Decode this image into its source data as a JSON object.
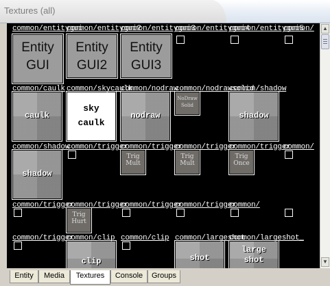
{
  "window": {
    "title": "Textures (all)"
  },
  "rows": [
    {
      "labels": [
        "common/entitygui",
        "common/entitygui2",
        "common/entitygui3",
        "common/entitygui4",
        "common/entitygui5",
        "common/"
      ],
      "thumbs": [
        {
          "kind": "entity",
          "line1": "Entity",
          "line2": "GUI"
        },
        {
          "kind": "entity",
          "line1": "Entity",
          "line2": "GUI2"
        },
        {
          "kind": "entity",
          "line1": "Entity",
          "line2": "GUI3"
        }
      ]
    },
    {
      "labels": [
        "common/caulk",
        "common/skycaulk",
        "common/nodraw",
        "common/nodrawsolid",
        "common/shadow"
      ],
      "thumbs": [
        {
          "kind": "checker",
          "word": "caulk"
        },
        {
          "kind": "sky",
          "word1": "sky",
          "word2": "caulk"
        },
        {
          "kind": "checker",
          "word": "nodraw"
        },
        {
          "kind": "small",
          "line1": "NoDraw",
          "line2": "Solid"
        },
        {
          "kind": "checker",
          "word": "shadow"
        }
      ]
    },
    {
      "labels": [
        "common/shadow",
        "common/trigger",
        "common/trigger",
        "common/trigger",
        "common/trigger",
        "common/"
      ],
      "thumbs": [
        {
          "kind": "checker",
          "word": "shadow"
        },
        {
          "kind": "small",
          "line1": "Trig",
          "line2": "Mult"
        },
        {
          "kind": "small",
          "line1": "Trig",
          "line2": "Mult"
        },
        {
          "kind": "small",
          "line1": "Trig",
          "line2": "Once"
        }
      ]
    },
    {
      "labels": [
        "common/trigger",
        "common/trigger",
        "common/trigger",
        "common/trigger",
        "common/"
      ],
      "thumbs": [
        {
          "kind": "small",
          "line1": "Trig",
          "line2": "Hurt"
        }
      ]
    },
    {
      "labels": [
        "common/trigger",
        "common/clip",
        "common/clip",
        "common/largeshot",
        "common/largeshot_"
      ],
      "thumbs": [
        {
          "kind": "checker",
          "word": "clip"
        },
        {
          "kind": "checker",
          "word": "shot"
        },
        {
          "kind": "checker",
          "word1": "large",
          "word2": "shot"
        }
      ]
    }
  ],
  "tabs": [
    "Entity",
    "Media",
    "Textures",
    "Console",
    "Groups"
  ],
  "active_tab": "Textures",
  "icons": {
    "scroll_up": "arrow-up-icon",
    "scroll_down": "arrow-down-icon"
  }
}
